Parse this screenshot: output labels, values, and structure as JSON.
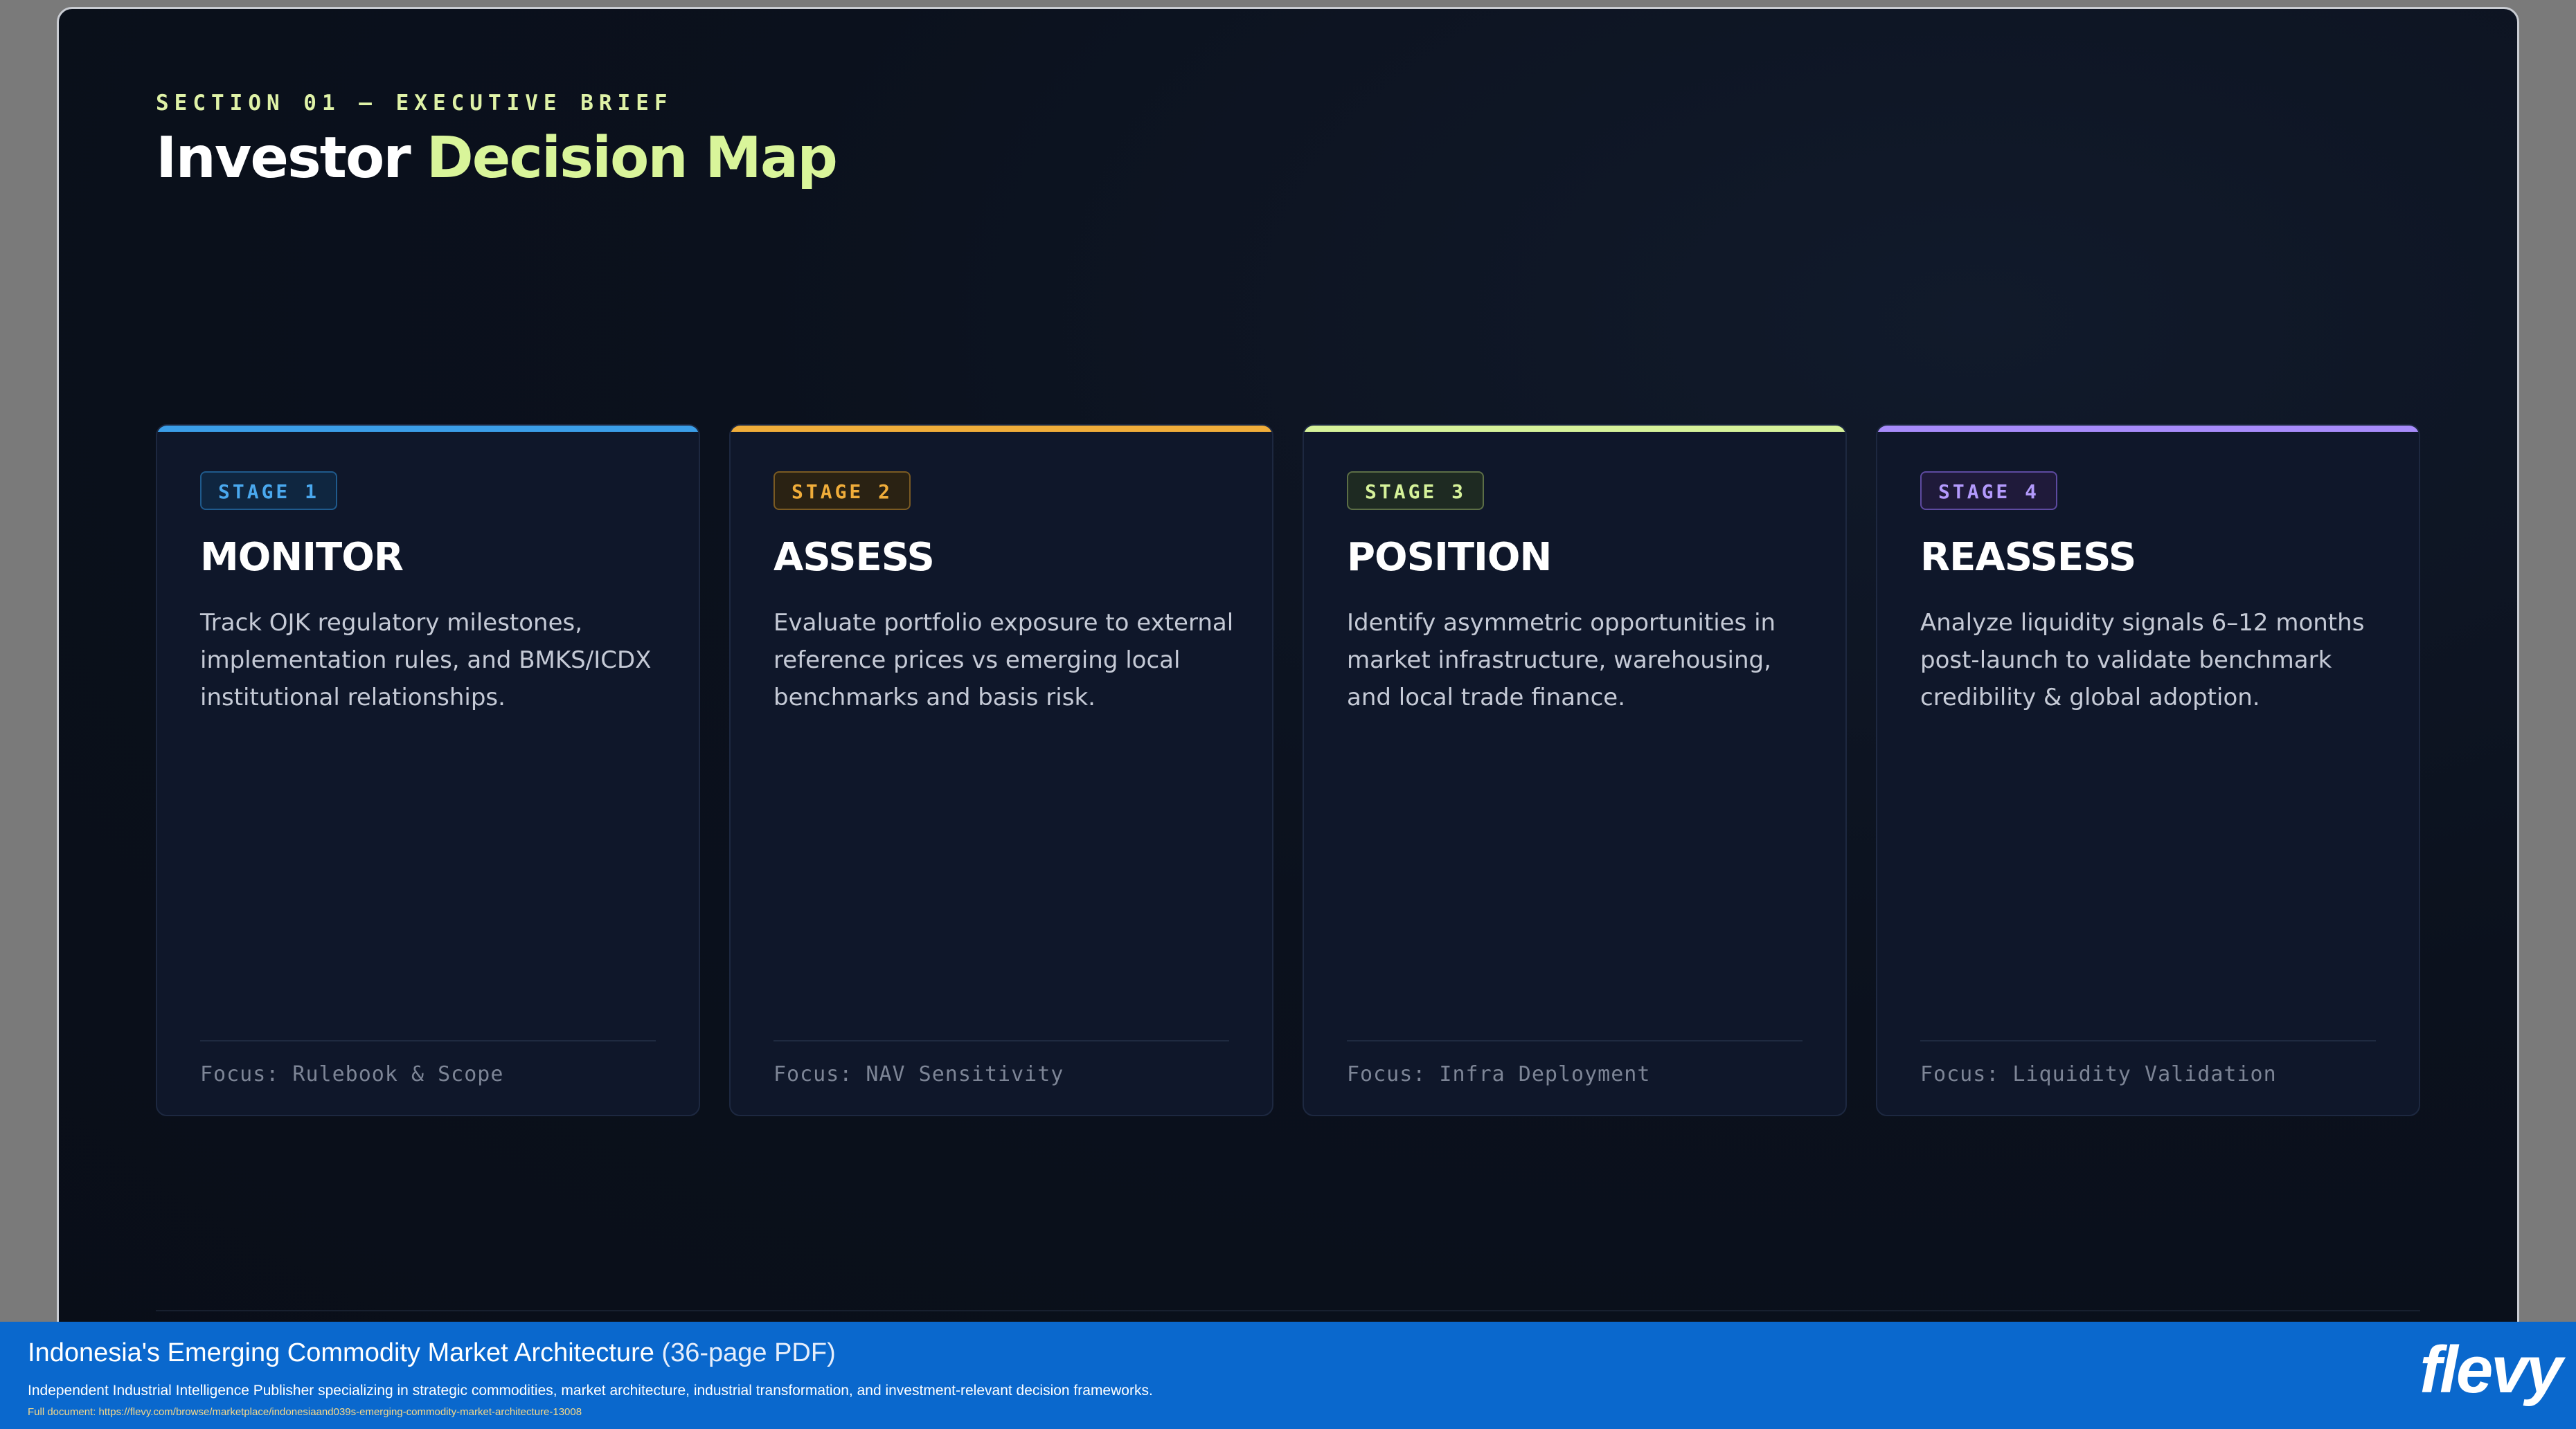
{
  "slide": {
    "eyebrow": "SECTION 01 — EXECUTIVE BRIEF",
    "title_part1": "Investor",
    "title_part2": "Decision Map"
  },
  "stages": [
    {
      "badge": "STAGE 1",
      "title": "MONITOR",
      "description": "Track OJK regulatory milestones, implementation rules, and BMKS/ICDX institutional relationships.",
      "focus": "Focus: Rulebook & Scope",
      "accent": "#3b9ee8"
    },
    {
      "badge": "STAGE 2",
      "title": "ASSESS",
      "description": "Evaluate portfolio exposure to external reference prices vs emerging local benchmarks and basis risk.",
      "focus": "Focus: NAV Sensitivity",
      "accent": "#f0ad3a"
    },
    {
      "badge": "STAGE 3",
      "title": "POSITION",
      "description": "Identify asymmetric opportunities in market infrastructure, warehousing, and local trade finance.",
      "focus": "Focus: Infra Deployment",
      "accent": "#d6f29a"
    },
    {
      "badge": "STAGE 4",
      "title": "REASSESS",
      "description": "Analyze liquidity signals 6–12 months post-launch to validate benchmark credibility & global adoption.",
      "focus": "Focus: Liquidity Validation",
      "accent": "#a78bfa"
    }
  ],
  "footer": {
    "title": "Indonesia's Emerging Commodity Market Architecture",
    "pages": "(36-page PDF)",
    "subtitle": "Independent Industrial Intelligence Publisher specializing in strategic commodities, market architecture, industrial transformation, and investment-relevant decision frameworks.",
    "link": "Full document: https://flevy.com/browse/marketplace/indonesiaand039s-emerging-commodity-market-architecture-13008",
    "logo": "flevy"
  }
}
